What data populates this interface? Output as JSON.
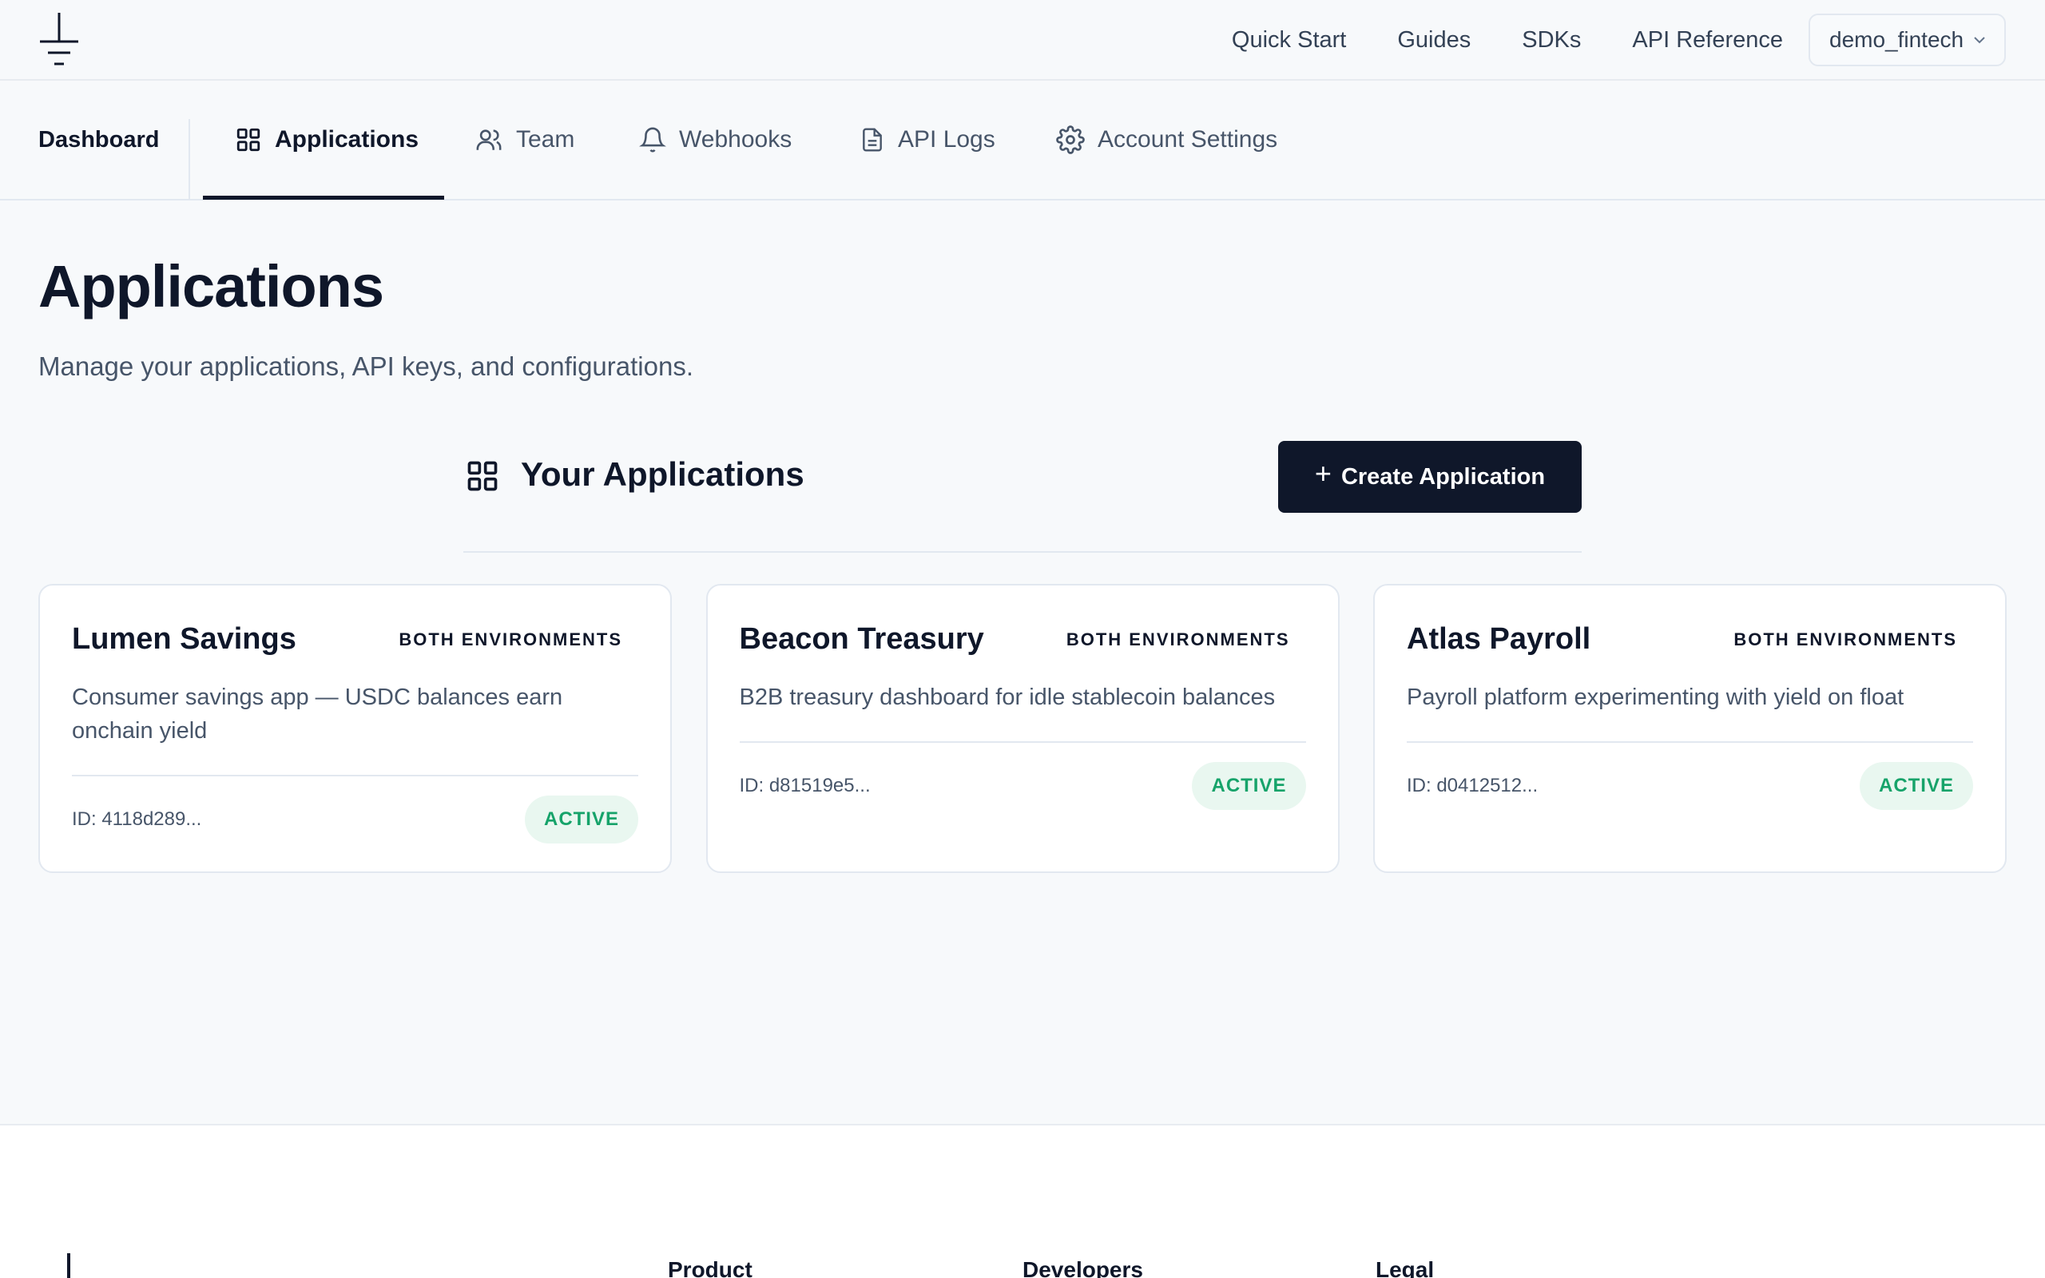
{
  "topnav": {
    "items": [
      "Quick Start",
      "Guides",
      "SDKs",
      "API Reference"
    ],
    "org": "demo_fintech"
  },
  "tabs": {
    "dashboard": "Dashboard",
    "items": [
      {
        "label": "Applications",
        "icon": "grid-icon",
        "active": true
      },
      {
        "label": "Team",
        "icon": "users-icon"
      },
      {
        "label": "Webhooks",
        "icon": "bell-icon"
      },
      {
        "label": "API Logs",
        "icon": "file-icon"
      },
      {
        "label": "Account Settings",
        "icon": "gear-icon"
      }
    ]
  },
  "page": {
    "title": "Applications",
    "subtitle": "Manage your applications, API keys, and configurations."
  },
  "section": {
    "title": "Your Applications",
    "create_label": "Create Application"
  },
  "apps": [
    {
      "name": "Lumen Savings",
      "env": "BOTH ENVIRONMENTS",
      "description": "Consumer savings app — USDC balances earn onchain yield",
      "id": "ID: 4118d289...",
      "status": "ACTIVE"
    },
    {
      "name": "Beacon Treasury",
      "env": "BOTH ENVIRONMENTS",
      "description": "B2B treasury dashboard for idle stablecoin balances",
      "id": "ID: d81519e5...",
      "status": "ACTIVE"
    },
    {
      "name": "Atlas Payroll",
      "env": "BOTH ENVIRONMENTS",
      "description": "Payroll platform experimenting with yield on float",
      "id": "ID: d0412512...",
      "status": "ACTIVE"
    }
  ],
  "footer": {
    "columns": [
      "Product",
      "Developers",
      "Legal"
    ]
  },
  "colors": {
    "primary": "#0f172a",
    "active_badge_text": "#16a36a",
    "active_badge_bg": "#e9f7f0",
    "background": "#f7f9fb"
  }
}
